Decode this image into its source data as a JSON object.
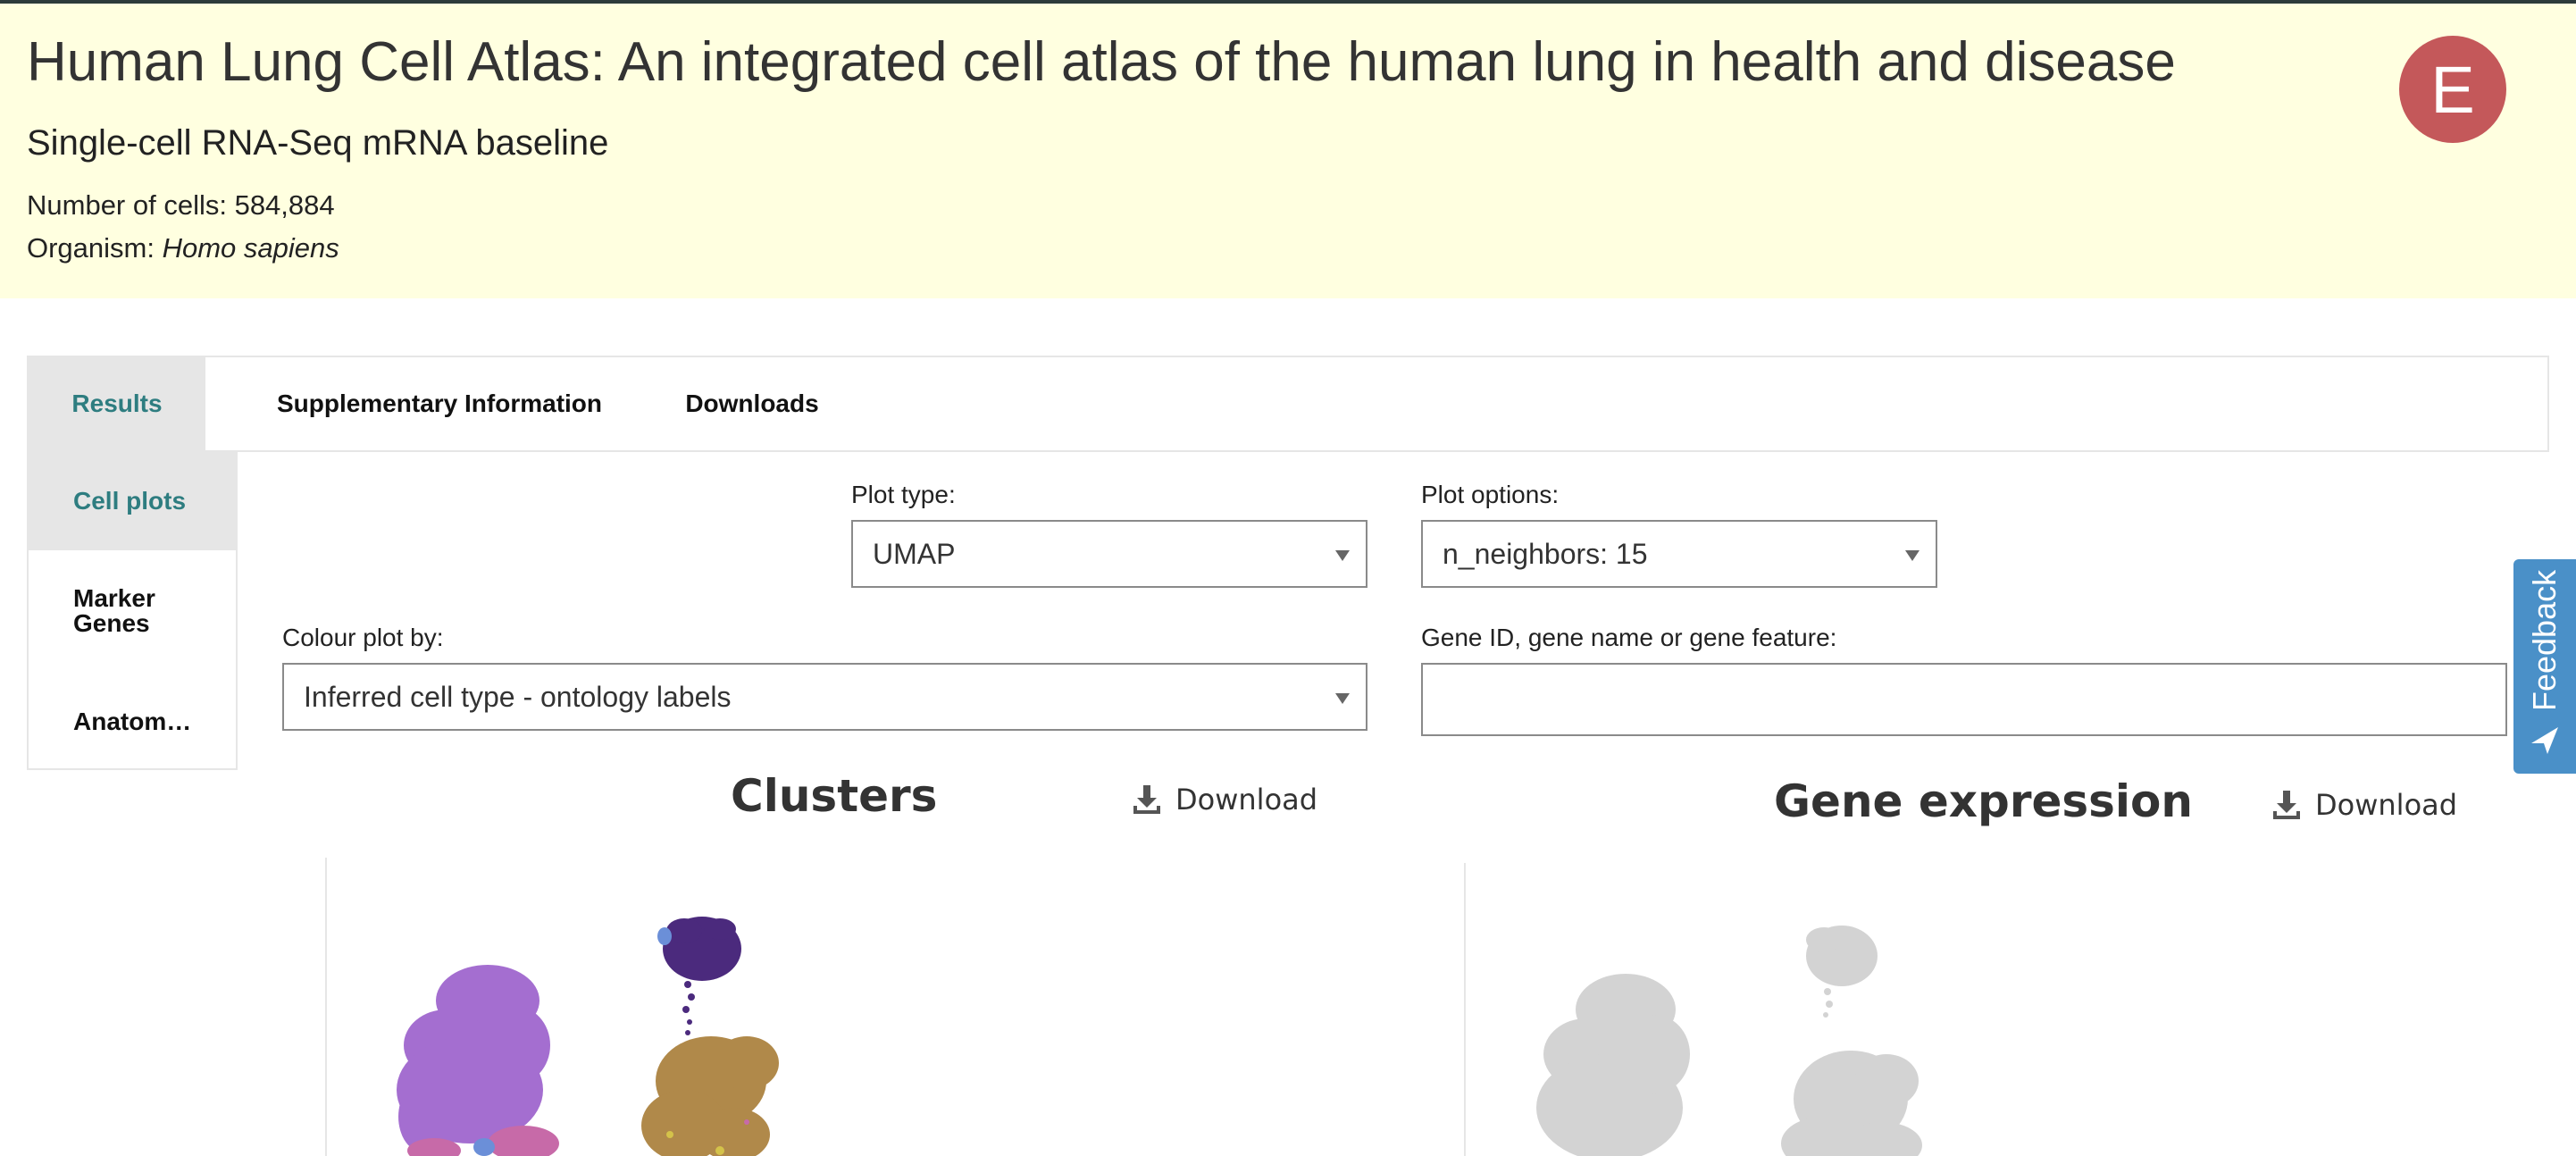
{
  "header": {
    "title": "Human Lung Cell Atlas: An integrated cell atlas of the human lung in health and disease",
    "subtitle": "Single-cell RNA-Seq mRNA baseline",
    "cells_label": "Number of cells: ",
    "cells_value": "584,884",
    "organism_label": "Organism: ",
    "organism_value": "Homo sapiens",
    "avatar_letter": "E"
  },
  "tabs": [
    {
      "label": "Results",
      "active": true
    },
    {
      "label": "Supplementary Information",
      "active": false
    },
    {
      "label": "Downloads",
      "active": false
    }
  ],
  "side_nav": [
    {
      "label": "Cell plots",
      "active": true
    },
    {
      "label": "Marker Genes",
      "active": false
    },
    {
      "label": "Anatom…",
      "active": false
    }
  ],
  "controls": {
    "plot_type_label": "Plot type:",
    "plot_type_value": "UMAP",
    "plot_options_label": "Plot options:",
    "plot_options_value": "n_neighbors: 15",
    "colour_label": "Colour plot by:",
    "colour_value": "Inferred cell type - ontology labels",
    "gene_label": "Gene ID, gene name or gene feature:",
    "gene_value": "",
    "gene_placeholder": ""
  },
  "plots": {
    "clusters_title": "Clusters",
    "gene_title": "Gene expression",
    "download_label": "Download"
  },
  "feedback": {
    "label": "Feedback"
  },
  "colors": {
    "header_bg": "#ffffe0",
    "accent_teal": "#2e7d80",
    "avatar": "#c4585a",
    "feedback": "#4a90c8",
    "cluster_purple": "#a46ed0",
    "cluster_darkpurple": "#4b2a7d",
    "cluster_gold": "#b0894a",
    "cluster_pink": "#c76aa8",
    "gene_grey": "#d3d3d3"
  }
}
